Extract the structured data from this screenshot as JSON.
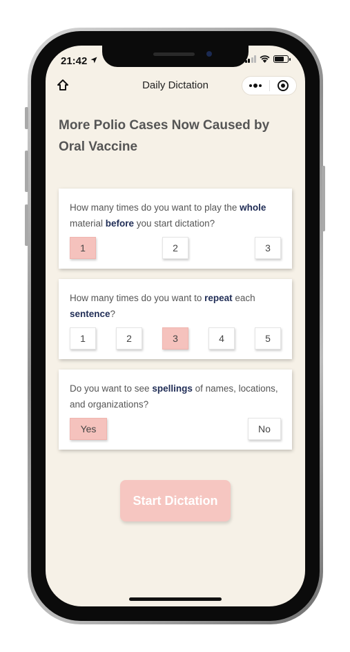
{
  "status_bar": {
    "time": "21:42"
  },
  "nav": {
    "title": "Daily Dictation"
  },
  "article": {
    "title": "More Polio Cases Now Caused by Oral Vaccine"
  },
  "questions": [
    {
      "parts": [
        "How many times do you want to play the ",
        "whole",
        " material ",
        "before",
        " you start dictation?"
      ],
      "options": [
        "1",
        "2",
        "3"
      ],
      "selected": "1"
    },
    {
      "parts": [
        "How many times do you want to ",
        "repeat",
        " each ",
        "sentence",
        "?"
      ],
      "options": [
        "1",
        "2",
        "3",
        "4",
        "5"
      ],
      "selected": "3"
    },
    {
      "parts": [
        "Do you want to see ",
        "spellings",
        " of names, locations, and organizations?"
      ],
      "options": [
        "Yes",
        "No"
      ],
      "selected": "Yes"
    }
  ],
  "start_button": {
    "label": "Start Dictation"
  },
  "colors": {
    "background": "#f6f1e7",
    "selected_option": "#f5c2bd",
    "start_button": "#f6c6c1",
    "highlight_text": "#1f2c55"
  },
  "icons": {
    "home": "home-outline-icon",
    "more": "more-dots-icon",
    "close": "target-circle-icon",
    "location": "location-arrow-icon",
    "signal": "cellular-signal-icon",
    "wifi": "wifi-icon",
    "battery": "battery-icon"
  }
}
